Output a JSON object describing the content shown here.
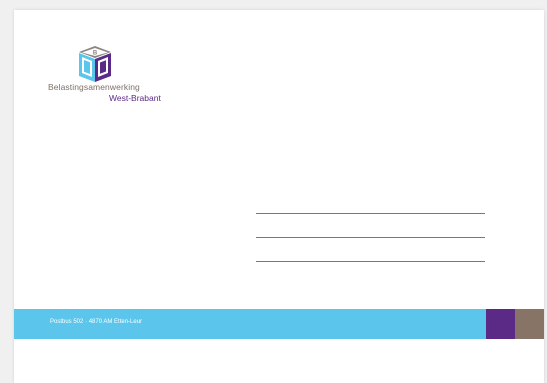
{
  "logo": {
    "name": "Belastingsamenwerking",
    "region": "West-Brabant",
    "icon": "bwb-cube-logo",
    "color_name": "#7d6f66",
    "color_region": "#5b2a86"
  },
  "footer": {
    "address": "Postbus 502 · 4870 AM  Etten-Leur",
    "color_main": "#5bc5ec",
    "color_purple": "#5b2a86",
    "color_taupe": "#877467"
  },
  "address_lines": {
    "color": "#877467",
    "count": 3
  }
}
